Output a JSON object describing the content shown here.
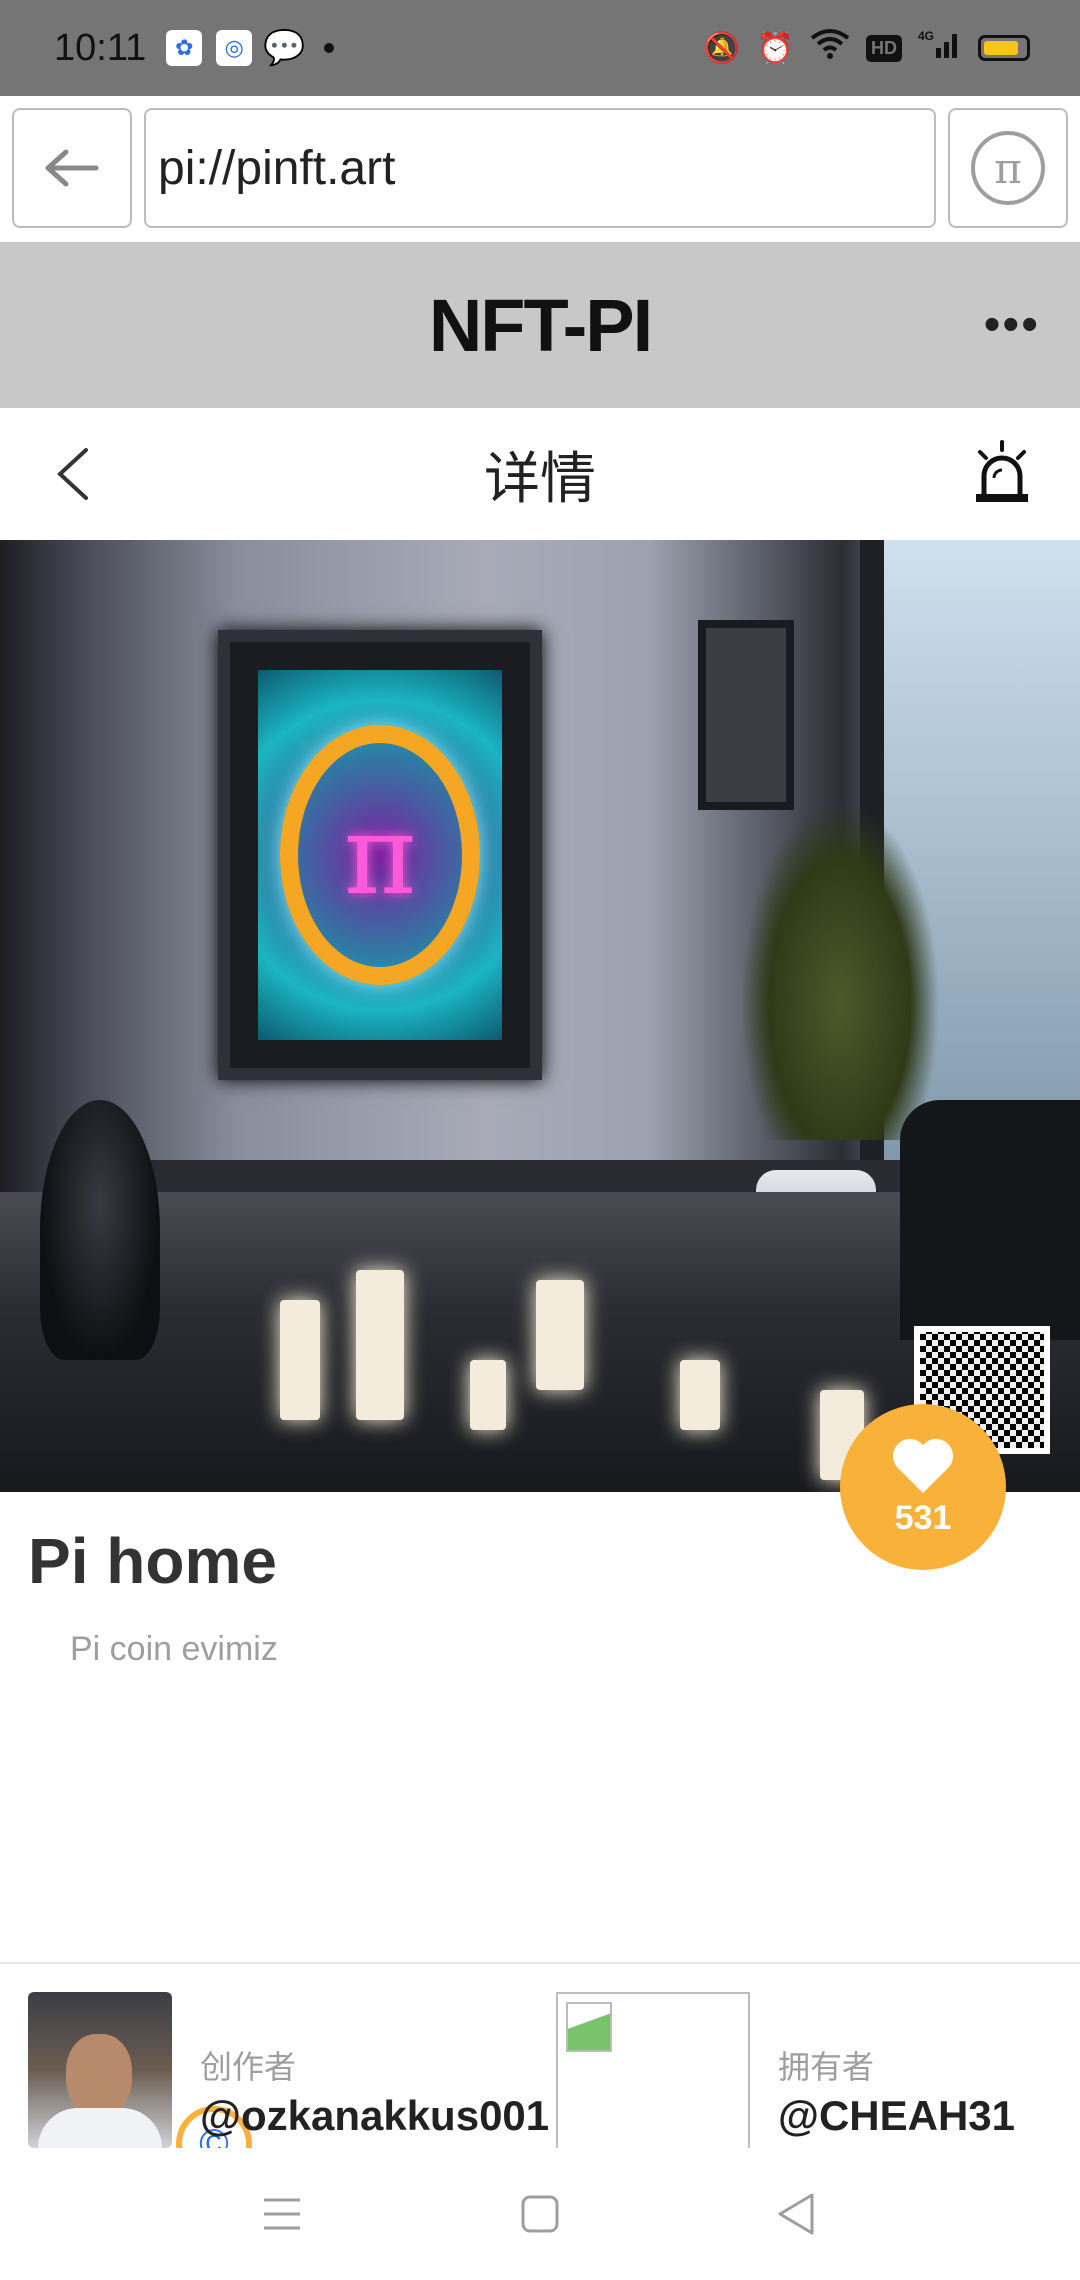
{
  "status_bar": {
    "time": "10:11",
    "app_icons": [
      "baidu-icon",
      "map-app-icon",
      "wechat-icon"
    ],
    "network": "4G"
  },
  "browser": {
    "url": "pi://pinft.art"
  },
  "app_header": {
    "title": "NFT-PI",
    "more_label": "•••"
  },
  "detail_nav": {
    "title": "详情"
  },
  "nft": {
    "title": "Pi home",
    "description": "Pi coin evimiz",
    "likes": "531"
  },
  "creator": {
    "label": "创作者",
    "name": "@ozkanakkus001"
  },
  "owner": {
    "label": "拥有者",
    "name": "@CHEAH31"
  },
  "colors": {
    "accent": "#f9b239",
    "status_bar": "#757575",
    "header_bg": "#c8c8c8"
  }
}
